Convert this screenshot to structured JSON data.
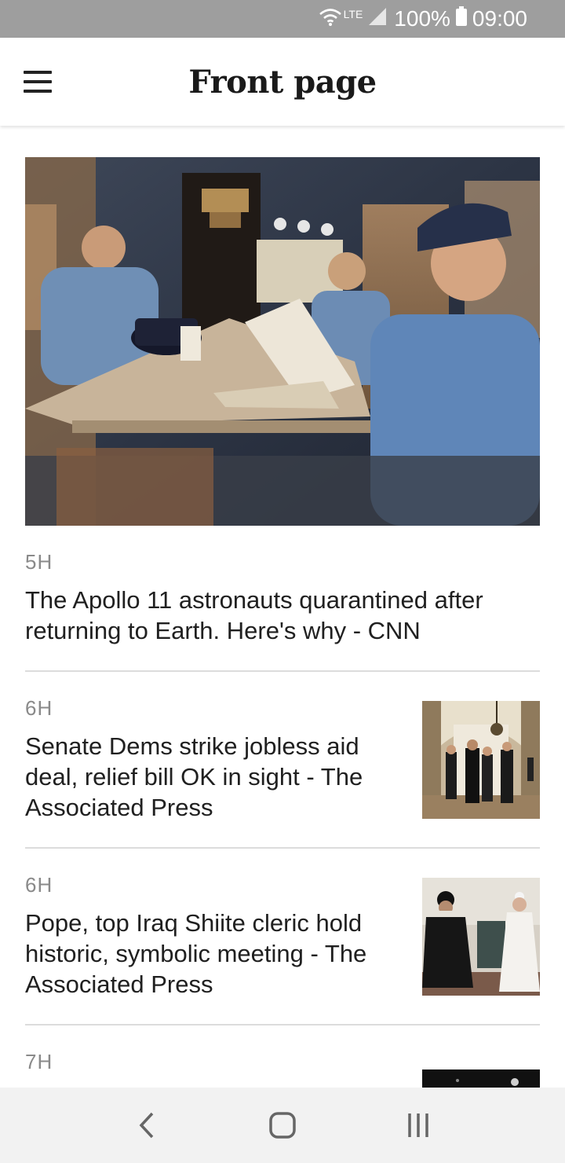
{
  "status_bar": {
    "network": "LTE",
    "battery": "100%",
    "time": "09:00",
    "icons": [
      "wifi-icon",
      "signal-icon",
      "battery-icon"
    ]
  },
  "header": {
    "title": "Front page",
    "menu_icon": "hamburger-menu-icon"
  },
  "feed": {
    "hero": {
      "time": "5H",
      "headline": "The Apollo 11 astronauts quarantined after returning to Earth. Here's why - CNN",
      "image": "apollo-astronauts-photo"
    },
    "items": [
      {
        "time": "6H",
        "headline": "Senate Dems strike jobless aid deal, relief bill OK in sight - The Associated Press",
        "image": "capitol-hallway-photo"
      },
      {
        "time": "6H",
        "headline": "Pope, top Iraq Shiite cleric hold historic, symbolic meeting - The Associated Press",
        "image": "pope-cleric-meeting-photo"
      },
      {
        "time": "7H",
        "headline": "",
        "image": "dark-thumbnail-photo"
      }
    ]
  },
  "nav_bar": {
    "icons": [
      "back-icon",
      "home-icon",
      "recents-icon"
    ]
  }
}
